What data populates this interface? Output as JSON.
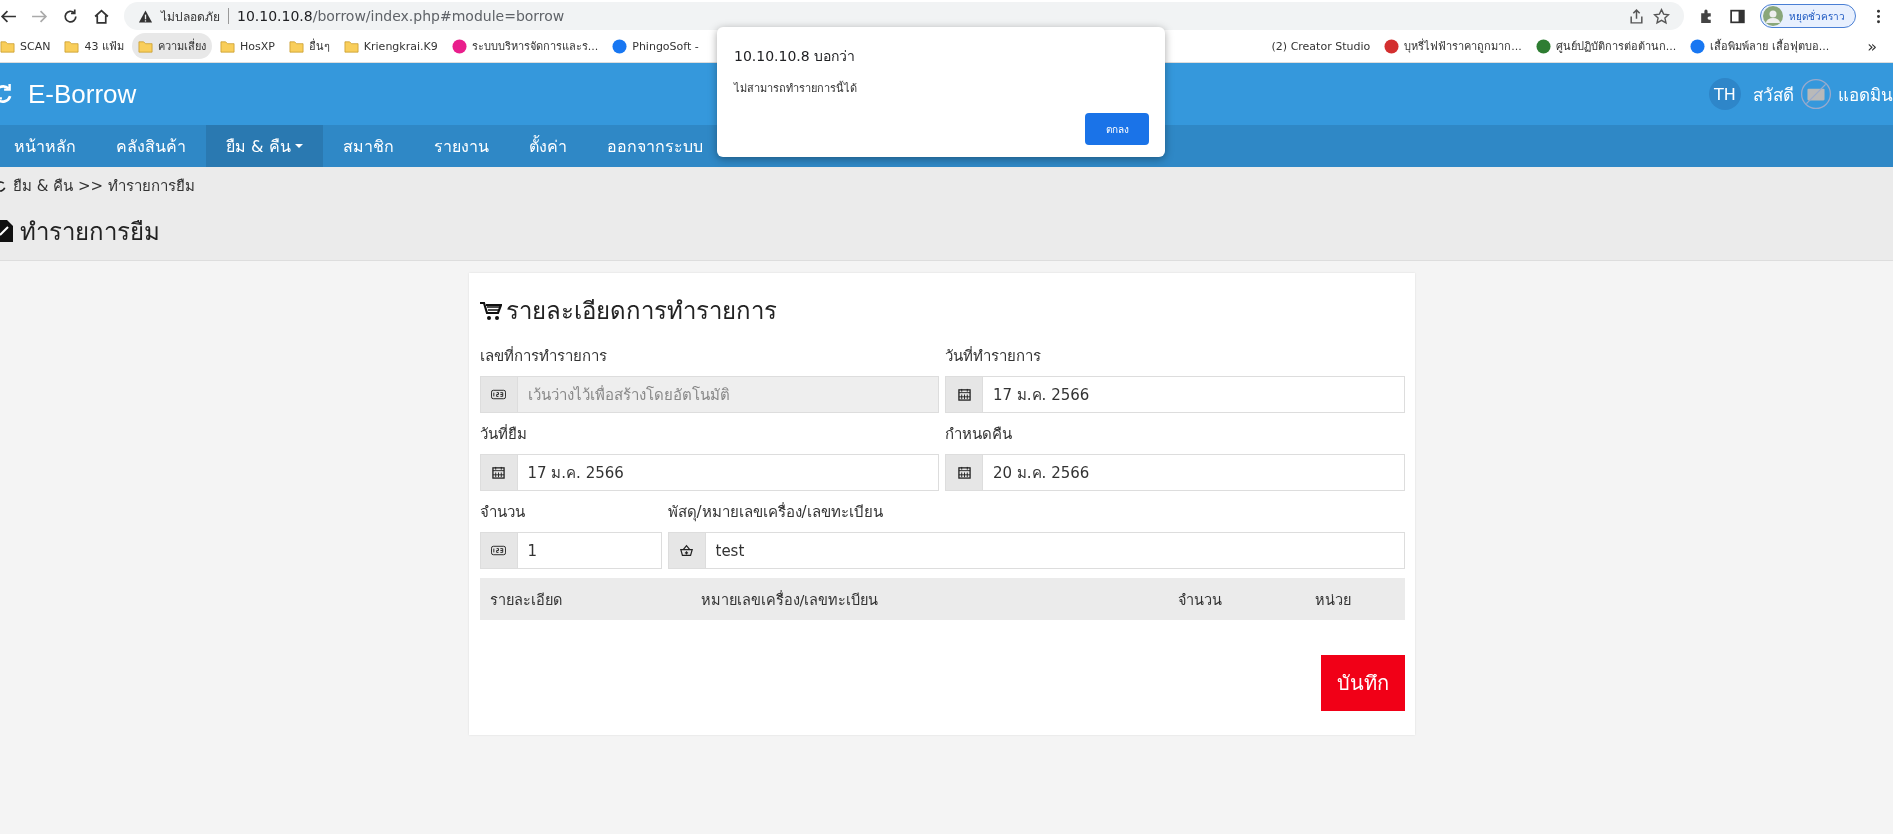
{
  "browser": {
    "address_prefix": "ไม่ปลอดภัย",
    "url_host": "10.10.10.8",
    "url_path": "/borrow/index.php#module=borrow",
    "profile_label": "หยุดชั่วคราว",
    "bookmarks": [
      {
        "label": "SCAN",
        "kind": "folder",
        "highlighted": false
      },
      {
        "label": "43 แฟ้ม",
        "kind": "folder",
        "highlighted": false
      },
      {
        "label": "ความเสี่ยง",
        "kind": "folder",
        "highlighted": true
      },
      {
        "label": "HosXP",
        "kind": "folder",
        "highlighted": false
      },
      {
        "label": "อื่นๆ",
        "kind": "folder",
        "highlighted": false
      },
      {
        "label": "Kriengkrai.K9",
        "kind": "folder",
        "highlighted": false
      },
      {
        "label": "ระบบบริหารจัดการและร...",
        "kind": "site-pink",
        "highlighted": false
      },
      {
        "label": "PhingoSoft -",
        "kind": "site-blue",
        "highlighted": false
      }
    ],
    "bookmarks_right": [
      {
        "label": "(2) Creator Studio",
        "kind": "none",
        "highlighted": false
      },
      {
        "label": "บุหรี่ไฟฟ้าราคาถูกมาก...",
        "kind": "site-red",
        "highlighted": false
      },
      {
        "label": "ศูนย์ปฏิบัติการต่อต้านก...",
        "kind": "site-green",
        "highlighted": false
      },
      {
        "label": "เสื้อพิมพ์ลาย เสื้อฟุตบอ...",
        "kind": "site-blue",
        "highlighted": false
      }
    ],
    "more": "»"
  },
  "app": {
    "brand": "E-Borrow",
    "lang": "TH",
    "greeting": "สวัสดี",
    "user": "แอดมิน"
  },
  "nav": [
    {
      "label": "หน้าหลัก",
      "selected": false,
      "dropdown": false
    },
    {
      "label": "คลังสินค้า",
      "selected": false,
      "dropdown": false
    },
    {
      "label": "ยืม & คืน",
      "selected": true,
      "dropdown": true
    },
    {
      "label": "สมาชิก",
      "selected": false,
      "dropdown": false
    },
    {
      "label": "รายงาน",
      "selected": false,
      "dropdown": false
    },
    {
      "label": "ตั้งค่า",
      "selected": false,
      "dropdown": false
    },
    {
      "label": "ออกจากระบบ",
      "selected": false,
      "dropdown": false
    }
  ],
  "breadcrumb": "ยืม & คืน >> ทำรายการยืม",
  "page_title": "ทำรายการยืม",
  "form": {
    "title": "รายละเอียดการทำรายการ",
    "rows": [
      [
        {
          "label": "เลขที่การทำรายการ",
          "kind": "number",
          "placeholder": "เว้นว่างไว้เพื่อสร้างโดยอัตโนมัติ",
          "disabled": true,
          "narrow": false
        },
        {
          "label": "วันที่ทำรายการ",
          "kind": "calendar",
          "value": "17 ม.ค. 2566",
          "disabled": false,
          "narrow": false
        }
      ],
      [
        {
          "label": "วันที่ยืม",
          "kind": "calendar",
          "value": "17 ม.ค. 2566",
          "disabled": false,
          "narrow": false
        },
        {
          "label": "กำหนดคืน",
          "kind": "calendar",
          "value": "20 ม.ค. 2566",
          "disabled": false,
          "narrow": false
        }
      ],
      [
        {
          "label": "จำนวน",
          "kind": "number",
          "value": "1",
          "disabled": false,
          "narrow": true
        },
        {
          "label": "พัสดุ/หมายเลขเครื่อง/เลขทะเบียน",
          "kind": "basket",
          "value": "test",
          "disabled": false,
          "narrow": false
        }
      ]
    ],
    "table": {
      "columns": [
        "รายละเอียด",
        "หมายเลขเครื่อง/เลขทะเบียน",
        "จำนวน",
        "หน่วย"
      ]
    },
    "save_button": "บันทึก"
  },
  "dialog": {
    "title": "10.10.10.8 บอกว่า",
    "message": "ไม่สามารถทำรายการนี้ได้",
    "ok_button": "ตกลง"
  }
}
